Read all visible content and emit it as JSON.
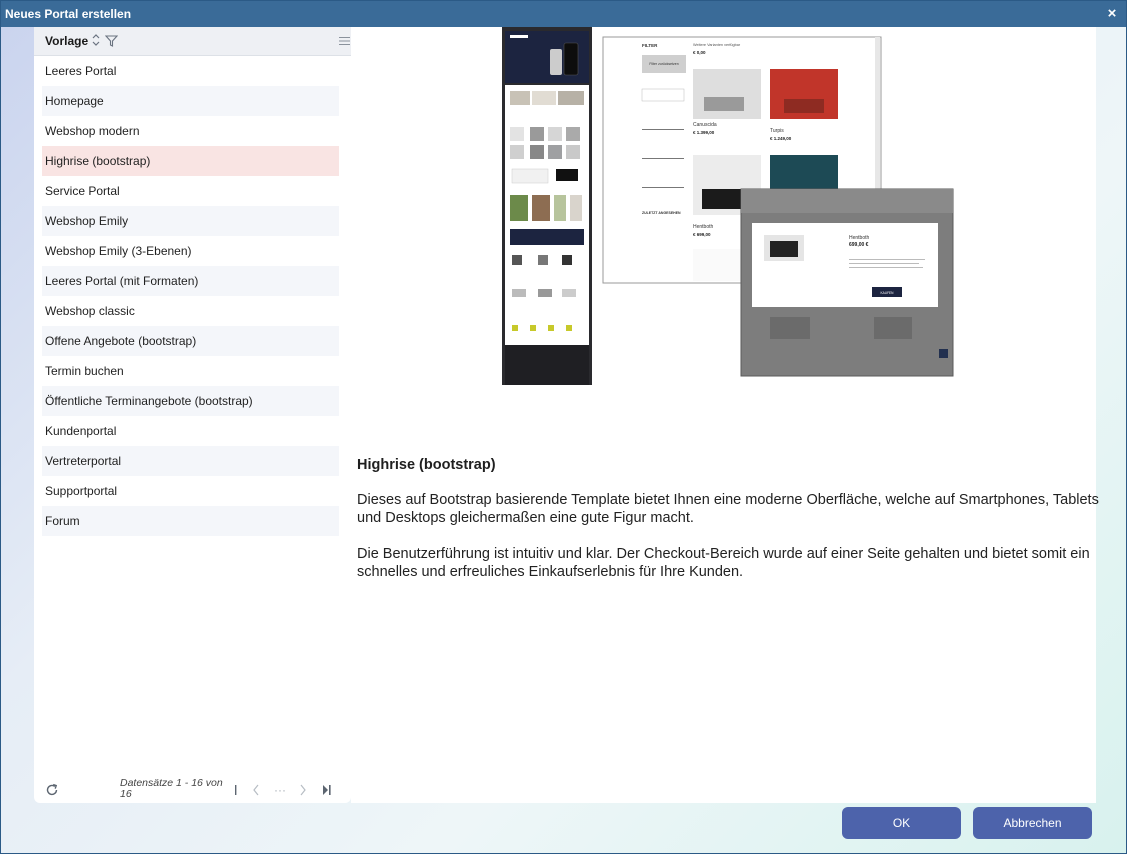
{
  "dialog": {
    "title": "Neues Portal erstellen",
    "close_glyph": "×"
  },
  "list": {
    "column_title": "Vorlage",
    "items": [
      {
        "label": "Leeres Portal"
      },
      {
        "label": "Homepage"
      },
      {
        "label": "Webshop modern"
      },
      {
        "label": "Highrise (bootstrap)",
        "selected": true
      },
      {
        "label": "Service Portal"
      },
      {
        "label": "Webshop Emily"
      },
      {
        "label": "Webshop Emily (3-Ebenen)"
      },
      {
        "label": "Leeres Portal (mit Formaten)"
      },
      {
        "label": "Webshop classic"
      },
      {
        "label": "Offene Angebote (bootstrap)"
      },
      {
        "label": "Termin buchen"
      },
      {
        "label": "Öffentliche Terminangebote (bootstrap)"
      },
      {
        "label": "Kundenportal"
      },
      {
        "label": "Vertreterportal"
      },
      {
        "label": "Supportportal"
      },
      {
        "label": "Forum"
      }
    ],
    "pager": {
      "text": "Datensätze 1 - 16 von 16",
      "dots": "···"
    }
  },
  "detail": {
    "title": "Highrise (bootstrap)",
    "paragraphs": [
      "Dieses auf Bootstrap basierende Template bietet Ihnen eine moderne Oberfläche, welche auf Smartphones, Tablets und Desktops gleichermaßen eine gute Figur macht.",
      "Die Benutzerführung ist intuitiv und klar. Der Checkout-Bereich wurde auf einer Seite gehalten und bietet somit ein schnelles und erfreuliches Einkaufserlebnis für Ihre Kunden."
    ],
    "preview": {
      "filter_label": "FILTER",
      "filter_button": "Filter zurücksetzen",
      "results_label": "Weitere Varianten verfügbar",
      "price_zero": "€ 0,00",
      "product1_name": "Canuscida",
      "product1_price": "€ 1.399,00",
      "product2_name": "Turpis",
      "product2_price": "€ 1.249,00",
      "product3_name": "Hentboth",
      "product3_price": "€ 699,00",
      "modal_product": "Hentboth",
      "modal_price": "699,00 €",
      "modal_button": "KAUFEN",
      "recent_label": "ZULETZT ANGESEHEN"
    }
  },
  "buttons": {
    "ok": "OK",
    "cancel": "Abbrechen"
  },
  "colors": {
    "titlebar": "#3a6b98",
    "button": "#4d63ab",
    "selected_row": "#f9e4e3"
  }
}
